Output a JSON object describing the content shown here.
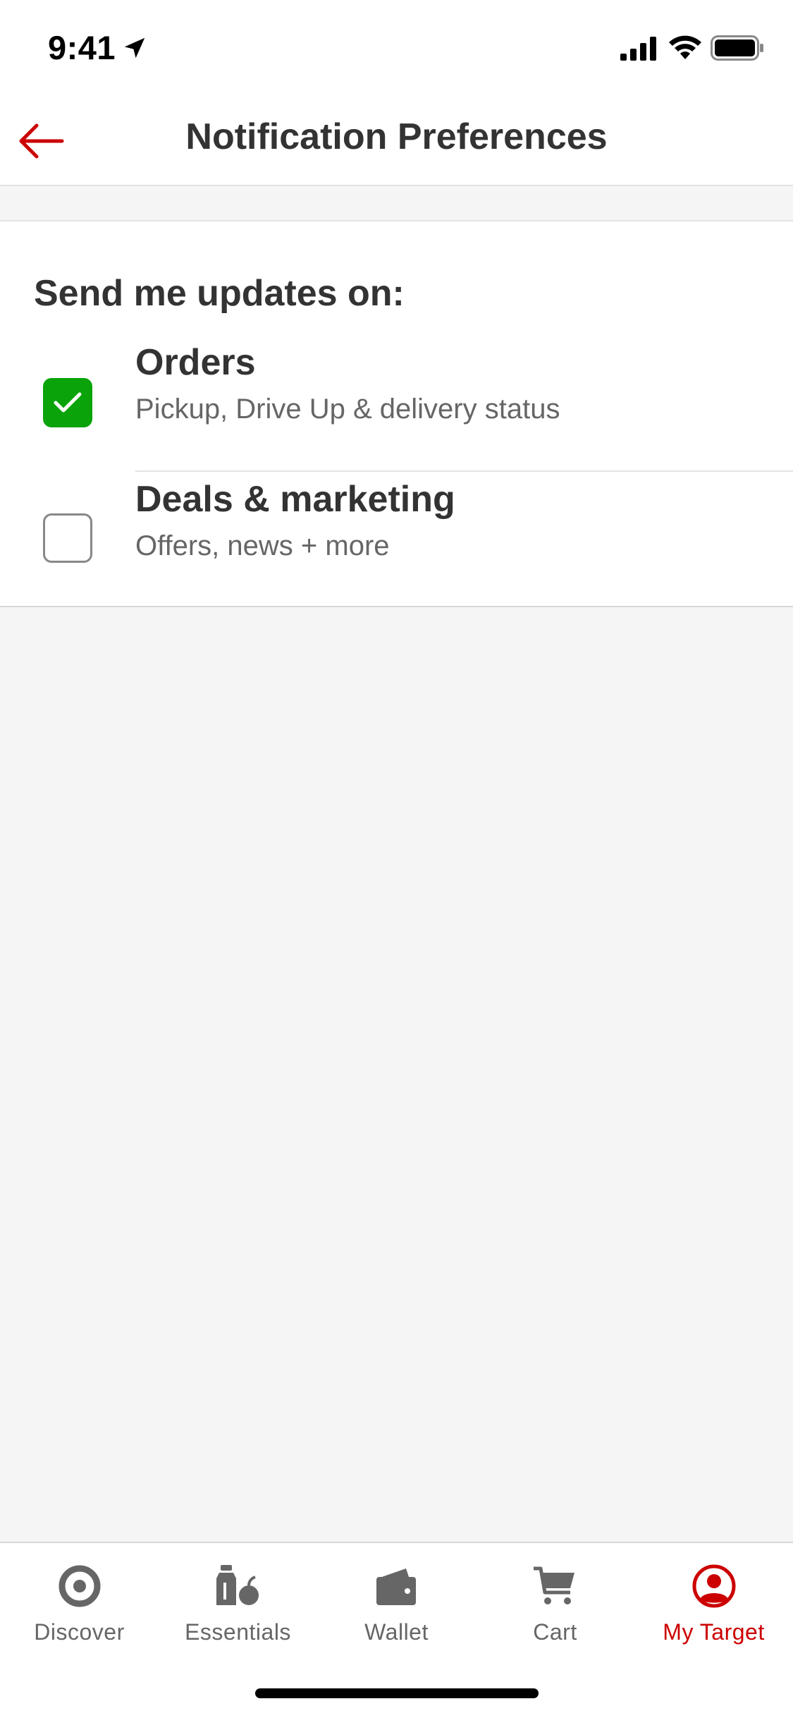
{
  "status_bar": {
    "time": "9:41"
  },
  "header": {
    "title": "Notification Preferences"
  },
  "section": {
    "heading": "Send me updates on:"
  },
  "preferences": [
    {
      "title": "Orders",
      "subtitle": "Pickup, Drive Up & delivery status",
      "checked": true
    },
    {
      "title": "Deals & marketing",
      "subtitle": "Offers, news + more",
      "checked": false
    }
  ],
  "tab_bar": {
    "items": [
      {
        "label": "Discover",
        "icon": "target-logo-icon",
        "active": false
      },
      {
        "label": "Essentials",
        "icon": "essentials-icon",
        "active": false
      },
      {
        "label": "Wallet",
        "icon": "wallet-icon",
        "active": false
      },
      {
        "label": "Cart",
        "icon": "cart-icon",
        "active": false
      },
      {
        "label": "My Target",
        "icon": "user-icon",
        "active": true
      }
    ]
  },
  "colors": {
    "accent": "#cc0000",
    "checked": "#0aa30a",
    "text": "#333333",
    "muted": "#666666"
  }
}
